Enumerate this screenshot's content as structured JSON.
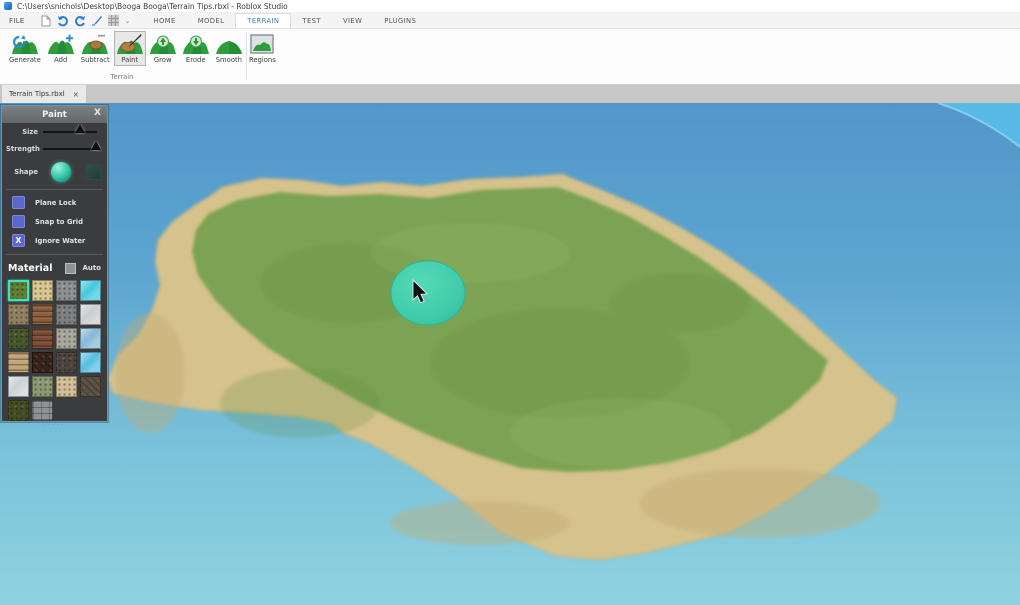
{
  "window": {
    "title": "C:\\Users\\snichols\\Desktop\\Booga Booga\\Terrain Tips.rbxl - Roblox Studio"
  },
  "menu": {
    "file_label": "FILE",
    "quick_access": [
      {
        "name": "new-file-icon"
      },
      {
        "name": "undo-icon"
      },
      {
        "name": "redo-icon"
      },
      {
        "name": "screenshot-icon"
      },
      {
        "name": "toggle-grid-icon"
      },
      {
        "name": "customize-dropdown-icon",
        "glyph": "⌄"
      }
    ],
    "tabs": [
      {
        "label": "HOME",
        "active": false
      },
      {
        "label": "MODEL",
        "active": false
      },
      {
        "label": "TERRAIN",
        "active": true
      },
      {
        "label": "TEST",
        "active": false
      },
      {
        "label": "VIEW",
        "active": false
      },
      {
        "label": "PLUGINS",
        "active": false
      }
    ]
  },
  "ribbon": {
    "group_label": "Terrain",
    "buttons": [
      {
        "label": "Generate",
        "icon": "generate-terrain-icon",
        "active": false
      },
      {
        "label": "Add",
        "icon": "add-terrain-icon",
        "active": false
      },
      {
        "label": "Subtract",
        "icon": "subtract-terrain-icon",
        "active": false
      },
      {
        "label": "Paint",
        "icon": "paint-terrain-icon",
        "active": true
      },
      {
        "label": "Grow",
        "icon": "grow-terrain-icon",
        "active": false
      },
      {
        "label": "Erode",
        "icon": "erode-terrain-icon",
        "active": false
      },
      {
        "label": "Smooth",
        "icon": "smooth-terrain-icon",
        "active": false
      },
      {
        "label": "Regions",
        "icon": "regions-terrain-icon",
        "active": false
      }
    ]
  },
  "document_tabs": [
    {
      "label": "Terrain Tips.rbxl",
      "close_label": "×",
      "active": true
    }
  ],
  "paint_panel": {
    "title": "Paint",
    "close_label": "X",
    "checked_glyph": "X",
    "sliders": [
      {
        "label": "Size",
        "value_pct": 70
      },
      {
        "label": "Strength",
        "value_pct": 100
      }
    ],
    "shape": {
      "label": "Shape",
      "options": [
        {
          "name": "sphere",
          "selected": true
        },
        {
          "name": "cube",
          "selected": false
        }
      ]
    },
    "checkboxes": [
      {
        "label": "Plane Lock",
        "checked": false
      },
      {
        "label": "Snap to Grid",
        "checked": false
      },
      {
        "label": "Ignore Water",
        "checked": true
      }
    ],
    "material_section": {
      "label": "Material",
      "auto_label": "Auto",
      "auto_checked": false
    },
    "materials": [
      {
        "name": "grass",
        "color": "#5e7e33",
        "pattern": "speckle",
        "selected": true
      },
      {
        "name": "sand",
        "color": "#d9c78f",
        "pattern": "speckle",
        "selected": false
      },
      {
        "name": "rock",
        "color": "#8e9193",
        "pattern": "speckle",
        "selected": false
      },
      {
        "name": "water",
        "color": "#45c8dd",
        "pattern": "sheen",
        "selected": false
      },
      {
        "name": "ground",
        "color": "#93805f",
        "pattern": "speckle",
        "selected": false
      },
      {
        "name": "wood-planks",
        "color": "#8a5f3c",
        "pattern": "stripes",
        "selected": false
      },
      {
        "name": "slate",
        "color": "#7e8081",
        "pattern": "speckle",
        "selected": false
      },
      {
        "name": "concrete",
        "color": "#c9cdd1",
        "pattern": "sheen",
        "selected": false
      },
      {
        "name": "leafy-grass",
        "color": "#47572c",
        "pattern": "speckle",
        "selected": false
      },
      {
        "name": "brick",
        "color": "#7b4c35",
        "pattern": "stripes",
        "selected": false
      },
      {
        "name": "salt",
        "color": "#aaa79b",
        "pattern": "speckle",
        "selected": false
      },
      {
        "name": "glacier",
        "color": "#84b9d6",
        "pattern": "sheen",
        "selected": false
      },
      {
        "name": "sandstone",
        "color": "#c2a478",
        "pattern": "stripes",
        "selected": false
      },
      {
        "name": "basalt",
        "color": "#33261f",
        "pattern": "crack",
        "selected": false
      },
      {
        "name": "asphalt",
        "color": "#4e453f",
        "pattern": "speckle",
        "selected": false
      },
      {
        "name": "ice",
        "color": "#55bde2",
        "pattern": "sheen",
        "selected": false
      },
      {
        "name": "snow",
        "color": "#ccd2d6",
        "pattern": "sheen",
        "selected": false
      },
      {
        "name": "cobblestone",
        "color": "#8c9a72",
        "pattern": "speckle",
        "selected": false
      },
      {
        "name": "limestone",
        "color": "#d2bf97",
        "pattern": "speckle",
        "selected": false
      },
      {
        "name": "cracked-lava",
        "color": "#575247",
        "pattern": "crack",
        "selected": false
      },
      {
        "name": "mud",
        "color": "#454d24",
        "pattern": "speckle",
        "selected": false
      },
      {
        "name": "pavement",
        "color": "#8f9294",
        "pattern": "bricks",
        "selected": false
      }
    ]
  },
  "viewport": {
    "water_stops": [
      "#4892c8",
      "#55a2cf",
      "#74c0d8",
      "#8ad0e0"
    ],
    "sky_color": "#56b9e6",
    "sand_color": "#d5c28c",
    "grass_color": "#7ca352",
    "brush_color": "#3ed0af"
  }
}
